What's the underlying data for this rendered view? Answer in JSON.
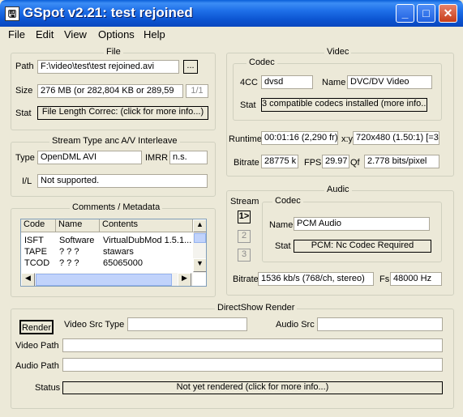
{
  "window": {
    "title": "GSpot v2.21: test rejoined",
    "icon_glyph": "🖫",
    "min": "_",
    "max": "□",
    "close": "✕"
  },
  "menu": [
    "File",
    "Edit",
    "View",
    "Options",
    "Help"
  ],
  "file": {
    "legend": "File",
    "path_label": "Path",
    "path_value": "F:\\video\\test\\test rejoined.avi",
    "browse": "...",
    "size_label": "Size",
    "size_value": "276 MB (or 282,804 KB or 289,59",
    "page": "1/1",
    "stat_label": "Stat",
    "stat_value": "File Length Correc: (click for more info...)"
  },
  "video": {
    "legend": "Videc",
    "codec_legend": "Codec",
    "fourcc_label": "4CC",
    "fourcc_value": "dvsd",
    "name_label": "Name",
    "name_value": "DVC/DV Video",
    "stat_label": "Stat",
    "stat_value": "3 compatible codecs installed (more info...)",
    "runtime_label": "Runtime",
    "runtime_value": "00:01:16 (2,290 fr)",
    "xy_label": "x:y",
    "xy_value": "720x480 (1.50:1) [=3:",
    "bitrate_label": "Bitrate",
    "bitrate_value": "28775 k",
    "fps_label": "FPS",
    "fps_value": "29.97",
    "qf_label": "Qf",
    "qf_value": "2.778 bits/pixel"
  },
  "stream": {
    "legend": "Stream Type anc A/V Interleave",
    "type_label": "Type",
    "type_value": "OpenDML AVI",
    "imrr_label": "IMRR",
    "imrr_value": "n.s.",
    "il_label": "I/L",
    "il_value": "Not supported."
  },
  "comments": {
    "legend": "Comments / Metadata",
    "columns": [
      "Code",
      "Name",
      "Contents"
    ],
    "rows": [
      [
        "ISFT",
        "Software",
        "VirtualDubMod 1.5.1..."
      ],
      [
        "TAPE",
        "? ? ?",
        "stawars"
      ],
      [
        "TCOD",
        "? ? ?",
        "65065000"
      ]
    ]
  },
  "audio": {
    "legend": "Audic",
    "stream_label": "Stream",
    "codec_legend": "Codec",
    "streams": [
      "1>",
      "2",
      "3"
    ],
    "name_label": "Name",
    "name_value": "PCM Audio",
    "stat_label": "Stat",
    "stat_value": "PCM: Nc Codec Required",
    "bitrate_label": "Bitrate",
    "bitrate_value": "1536 kb/s (768/ch, stereo)",
    "fs_label": "Fs",
    "fs_value": "48000 Hz"
  },
  "directshow": {
    "legend": "DirectShow Render",
    "render_button": "Render",
    "video_src_type_label": "Video Src Type",
    "video_src_type_value": "",
    "audio_src_label": "Audio Src",
    "audio_src_value": "",
    "video_path_label": "Video Path",
    "video_path_value": "",
    "audio_path_label": "Audio Path",
    "audio_path_value": "",
    "status_label": "Status",
    "status_value": "Not yet rendered (click for more info...)"
  }
}
